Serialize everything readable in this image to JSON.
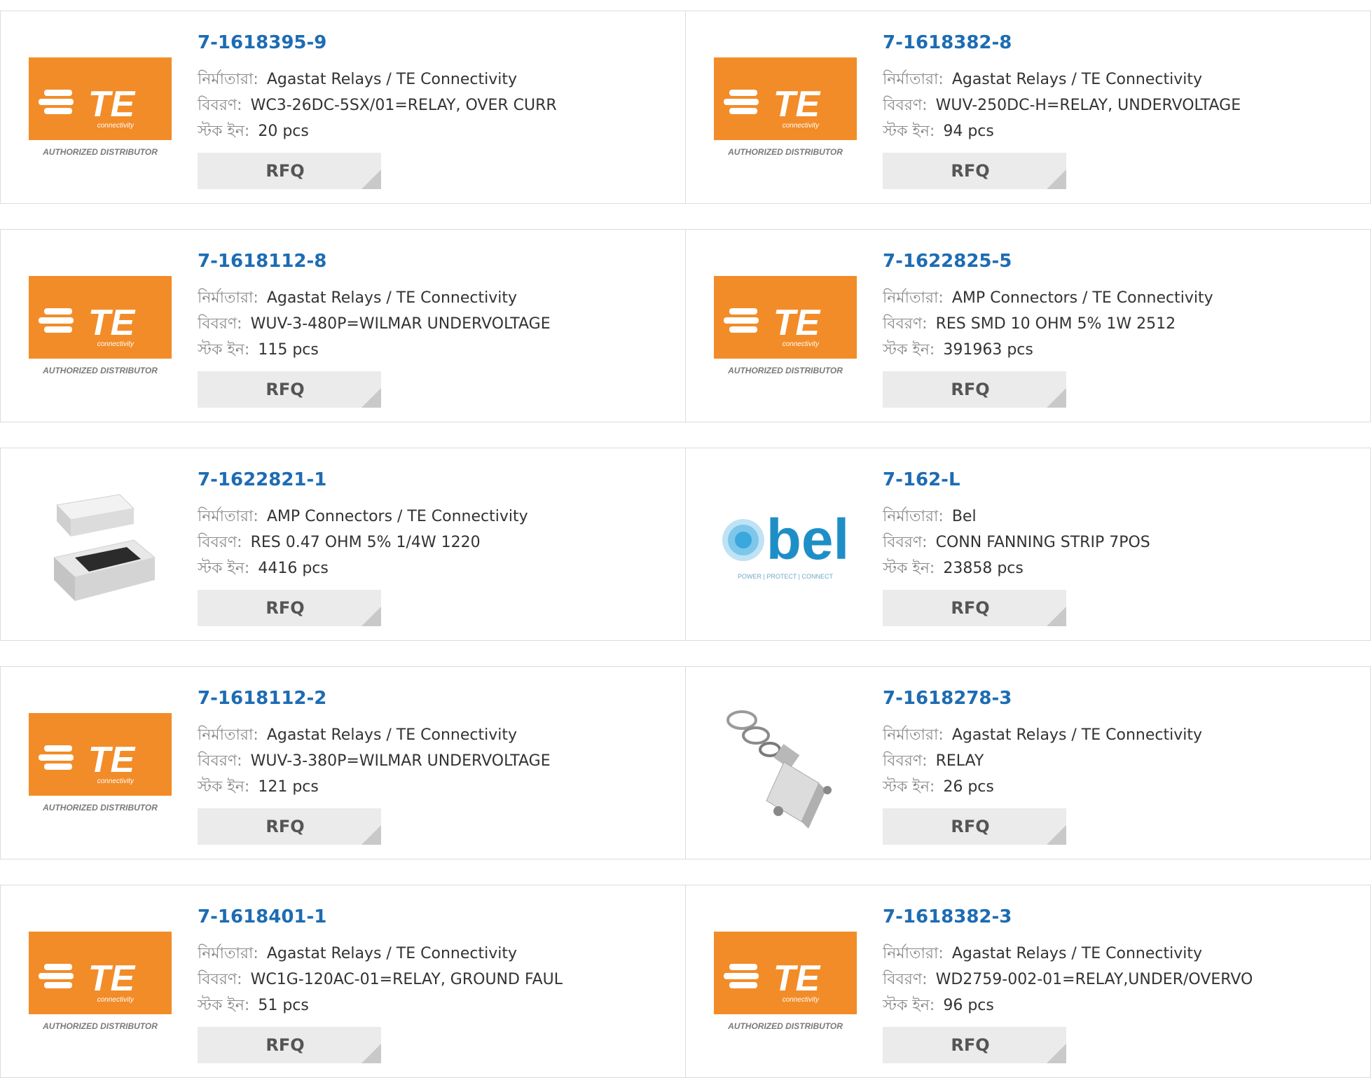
{
  "labels": {
    "manufacturer": "নির্মাতারা:",
    "description": "বিবরণ:",
    "stock": "স্টক ইন:",
    "rfq": "RFQ"
  },
  "logos": {
    "te": {
      "brand": "TE",
      "sub": "connectivity",
      "badge": "AUTHORIZED DISTRIBUTOR",
      "color": "#f28c28"
    },
    "bel": {
      "brand": "bel",
      "tagline": "POWER | PROTECT | CONNECT",
      "color": "#1e8fc6"
    }
  },
  "products": [
    {
      "part": "7-1618395-9",
      "manufacturer": "Agastat Relays / TE Connectivity",
      "description": "WC3-26DC-5SX/01=RELAY, OVER CURR",
      "stock": "20 pcs",
      "image": "te-logo"
    },
    {
      "part": "7-1618382-8",
      "manufacturer": "Agastat Relays / TE Connectivity",
      "description": "WUV-250DC-H=RELAY, UNDERVOLTAGE",
      "stock": "94 pcs",
      "image": "te-logo"
    },
    {
      "part": "7-1618112-8",
      "manufacturer": "Agastat Relays / TE Connectivity",
      "description": "WUV-3-480P=WILMAR UNDERVOLTAGE",
      "stock": "115 pcs",
      "image": "te-logo"
    },
    {
      "part": "7-1622825-5",
      "manufacturer": "AMP Connectors / TE Connectivity",
      "description": "RES SMD 10 OHM 5% 1W 2512",
      "stock": "391963 pcs",
      "image": "te-logo"
    },
    {
      "part": "7-1622821-1",
      "manufacturer": "AMP Connectors / TE Connectivity",
      "description": "RES 0.47 OHM 5% 1/4W 1220",
      "stock": "4416 pcs",
      "image": "smd-resistor"
    },
    {
      "part": "7-162-L",
      "manufacturer": "Bel",
      "description": "CONN FANNING STRIP 7POS",
      "stock": "23858 pcs",
      "image": "bel-logo"
    },
    {
      "part": "7-1618112-2",
      "manufacturer": "Agastat Relays / TE Connectivity",
      "description": "WUV-3-380P=WILMAR UNDERVOLTAGE",
      "stock": "121 pcs",
      "image": "te-logo"
    },
    {
      "part": "7-1618278-3",
      "manufacturer": "Agastat Relays / TE Connectivity",
      "description": "RELAY",
      "stock": "26 pcs",
      "image": "relay-photo"
    },
    {
      "part": "7-1618401-1",
      "manufacturer": "Agastat Relays / TE Connectivity",
      "description": "WC1G-120AC-01=RELAY, GROUND FAUL",
      "stock": "51 pcs",
      "image": "te-logo"
    },
    {
      "part": "7-1618382-3",
      "manufacturer": "Agastat Relays / TE Connectivity",
      "description": "WD2759-002-01=RELAY,UNDER/OVERVO",
      "stock": "96 pcs",
      "image": "te-logo"
    }
  ]
}
